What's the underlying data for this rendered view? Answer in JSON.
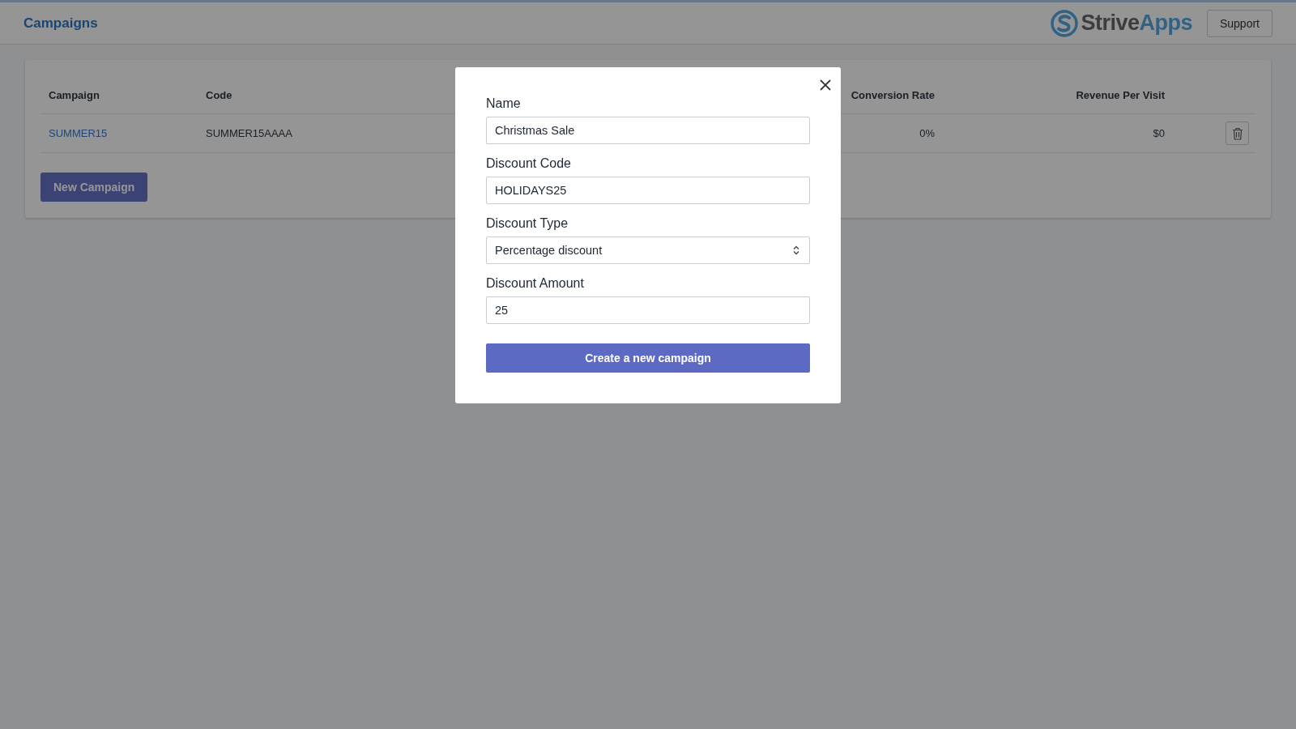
{
  "header": {
    "title": "Campaigns",
    "logo": {
      "first": "Strive",
      "second": "Apps"
    },
    "support_button": "Support"
  },
  "table": {
    "columns": [
      {
        "label": "Campaign"
      },
      {
        "label": "Code"
      },
      {
        "label": "Conversion Rate"
      },
      {
        "label": "Revenue Per Visit"
      }
    ],
    "rows": [
      {
        "cells": [
          "SUMMER15",
          "SUMMER15AAAA",
          "0%",
          "$0"
        ]
      }
    ]
  },
  "new_campaign_button": "New Campaign",
  "modal": {
    "fields": [
      {
        "kind": "text",
        "label": "Name",
        "value": "Christmas Sale"
      },
      {
        "kind": "text",
        "label": "Discount Code",
        "value": "HOLIDAYS25"
      },
      {
        "kind": "select",
        "label": "Discount Type",
        "value": "Percentage discount"
      },
      {
        "kind": "text",
        "label": "Discount Amount",
        "value": "25"
      }
    ],
    "submit_button": "Create a new campaign"
  }
}
